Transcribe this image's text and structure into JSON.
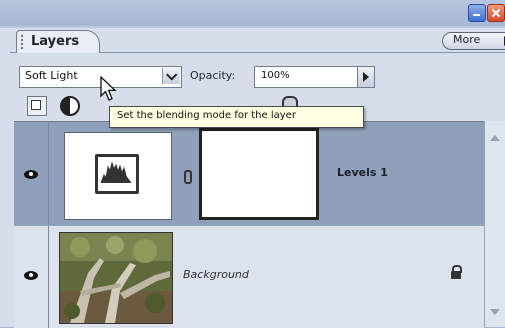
{
  "panel": {
    "tab_label": "Layers",
    "more_label": "More"
  },
  "controls": {
    "blend_mode": "Soft Light",
    "opacity_label": "Opacity:",
    "opacity_value": "100%"
  },
  "tooltip": {
    "text": "Set the blending mode for the layer"
  },
  "layers": [
    {
      "name": "Levels 1",
      "type": "adjustment",
      "selected": true,
      "visible": true
    },
    {
      "name": "Background",
      "type": "image",
      "selected": false,
      "visible": true,
      "locked": true
    }
  ],
  "icons": {
    "adjustment_thumb": "levels-histogram-icon",
    "lock": "lock-icon",
    "visibility": "eye-icon"
  },
  "colors": {
    "selected_row": "#8fa0ba",
    "tooltip_bg": "#ffffe1"
  }
}
